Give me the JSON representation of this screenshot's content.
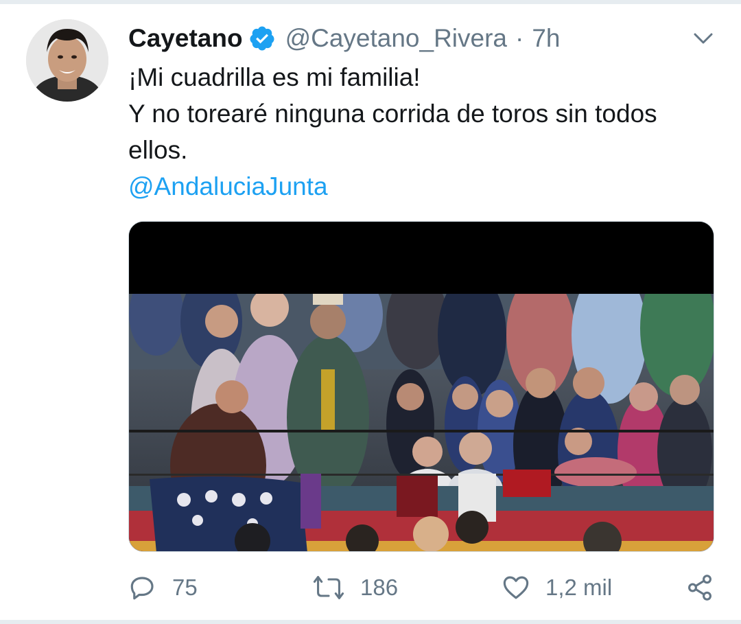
{
  "tweet": {
    "display_name": "Cayetano",
    "handle": "@Cayetano_Rivera",
    "separator": "·",
    "time": "7h",
    "text_lines": [
      "¡Mi cuadrilla es mi familia!",
      "Y no torearé ninguna corrida de toros sin todos",
      "ellos."
    ],
    "mention": "@AndaluciaJunta"
  },
  "actions": {
    "replies": "75",
    "retweets": "186",
    "likes": "1,2 mil"
  },
  "icons": {
    "verified": "verified-badge-icon",
    "menu": "chevron-down-icon",
    "reply": "speech-bubble-icon",
    "retweet": "retweet-arrows-icon",
    "like": "heart-icon",
    "share": "share-nodes-icon"
  },
  "colors": {
    "accent": "#1da1f2",
    "secondary_text": "#657786",
    "primary_text": "#14171a",
    "divider": "#e6ecf0"
  }
}
